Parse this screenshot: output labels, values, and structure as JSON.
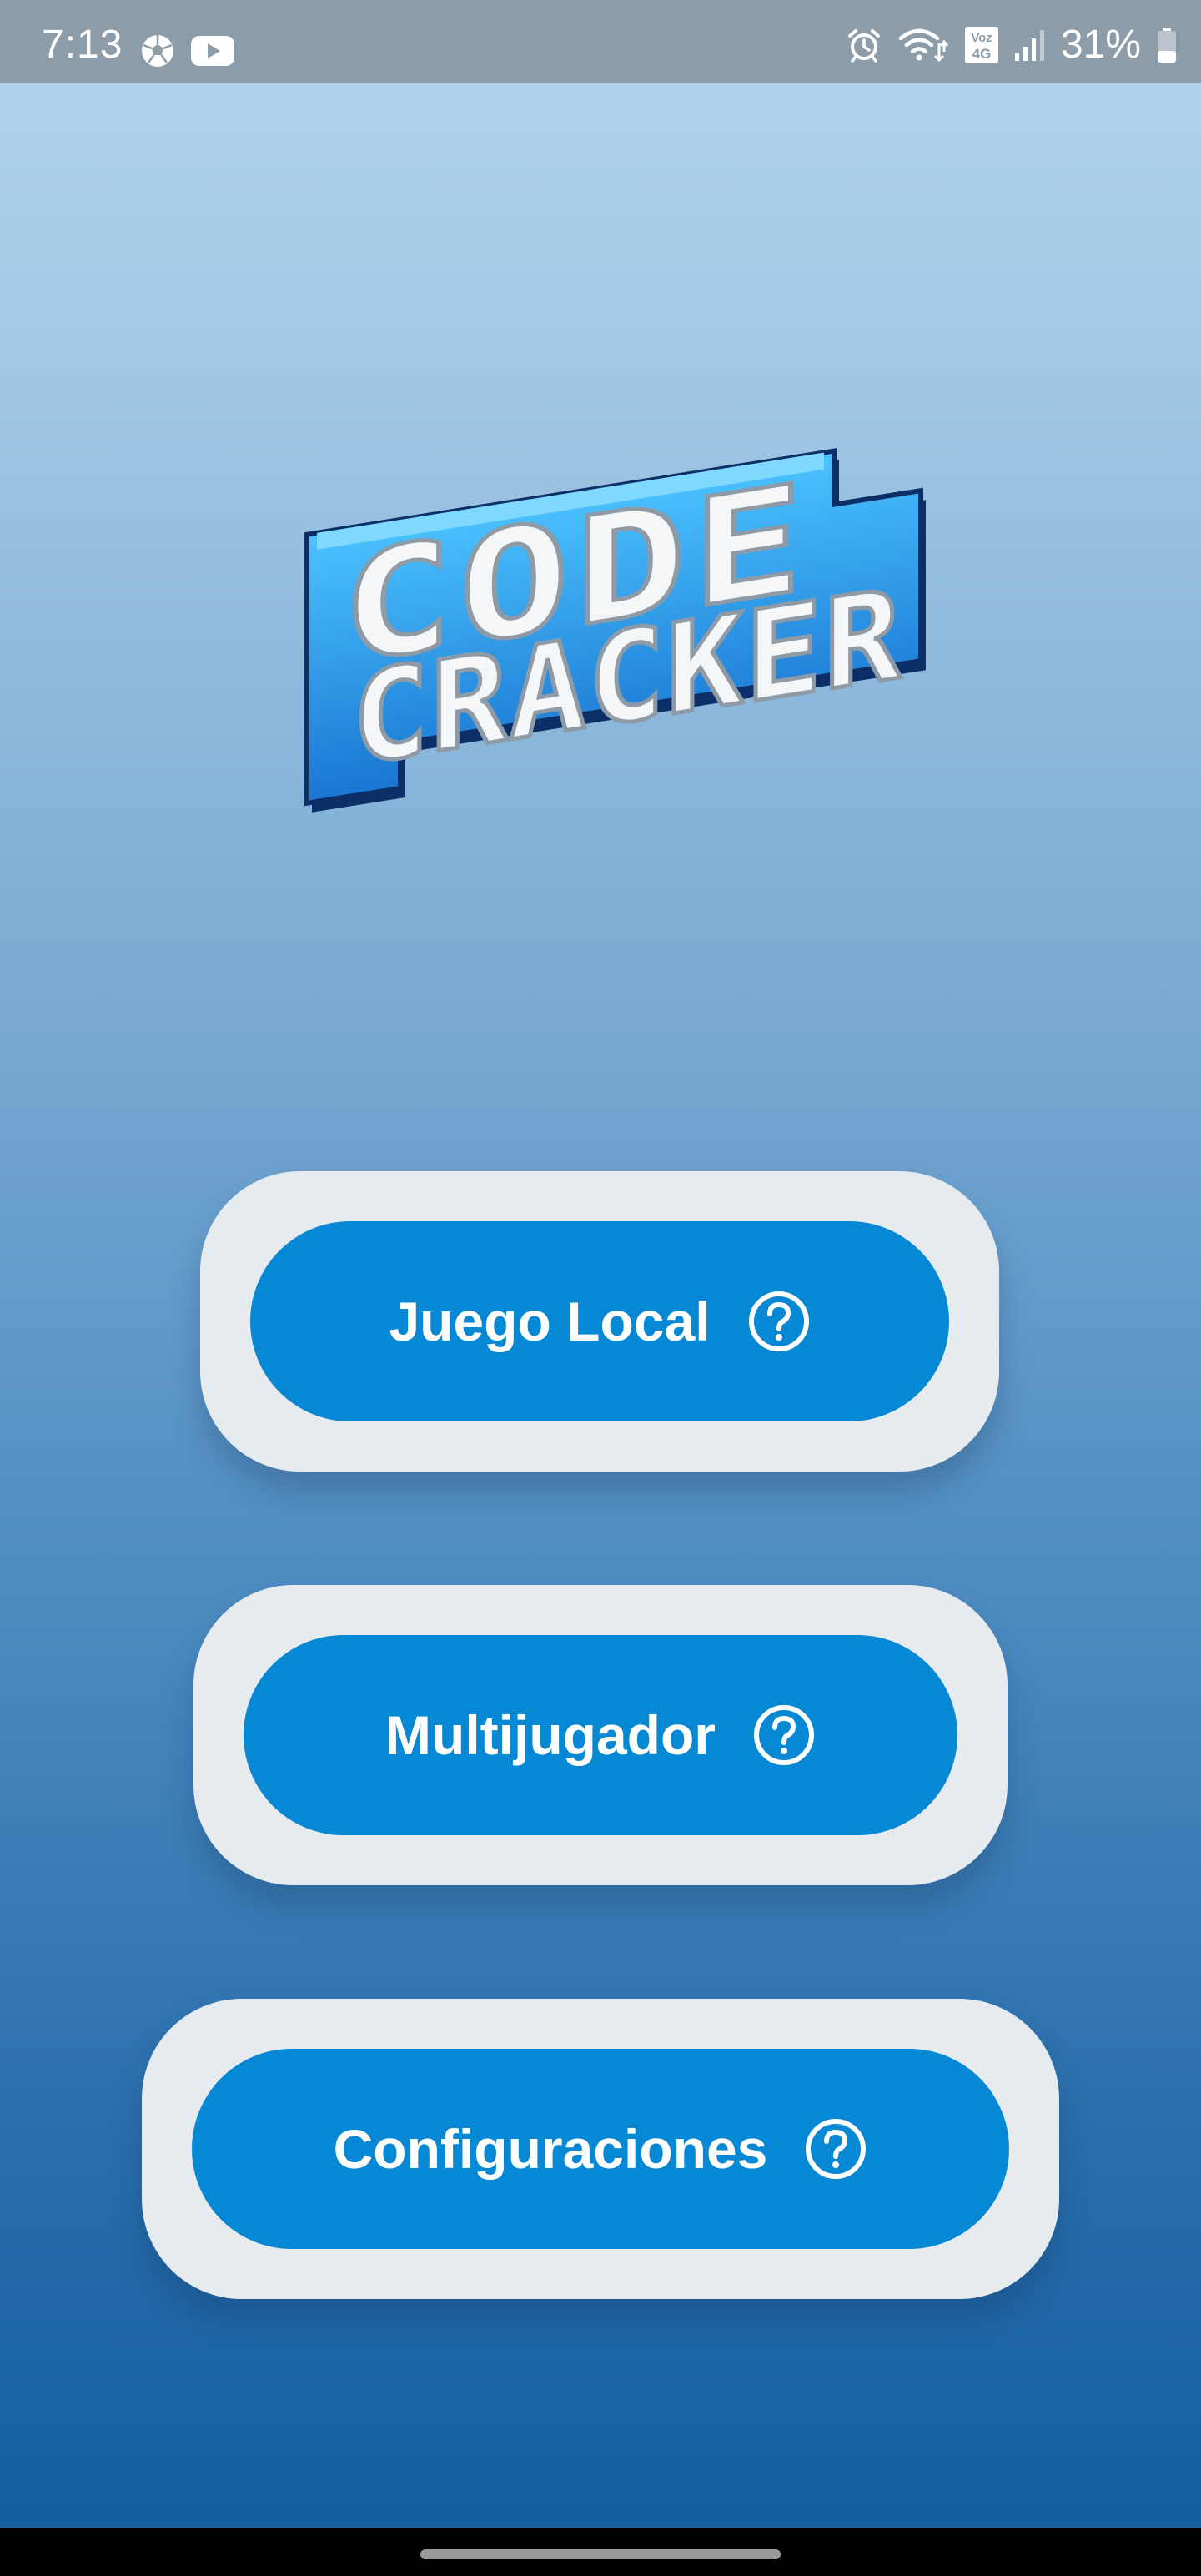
{
  "status_bar": {
    "time": "7:13",
    "left_icons": [
      "soccer-ball-icon",
      "youtube-icon"
    ],
    "right_icons": [
      "alarm-icon",
      "wifi-calling-icon",
      "volte-4g-icon",
      "signal-icon",
      "battery-icon"
    ],
    "volte_top": "Voz",
    "volte_bottom": "4G",
    "battery_percent": "31%",
    "battery_level": 0.31
  },
  "logo": {
    "line1": "CODE",
    "line2": "CRACKER"
  },
  "menu": {
    "items": [
      {
        "label": "Juego Local",
        "icon": "help-icon"
      },
      {
        "label": "Multijugador",
        "icon": "help-icon"
      },
      {
        "label": "Configuraciones",
        "icon": "help-icon"
      }
    ]
  },
  "colors": {
    "background_top": "#b6d6ec",
    "background_bottom": "#115c9f",
    "button": "#0788d4",
    "button_card": "#e6ebf0",
    "status_bar": "#8d9ca9",
    "logo_blue": "#1f8be0",
    "logo_dark": "#0b2f66"
  }
}
